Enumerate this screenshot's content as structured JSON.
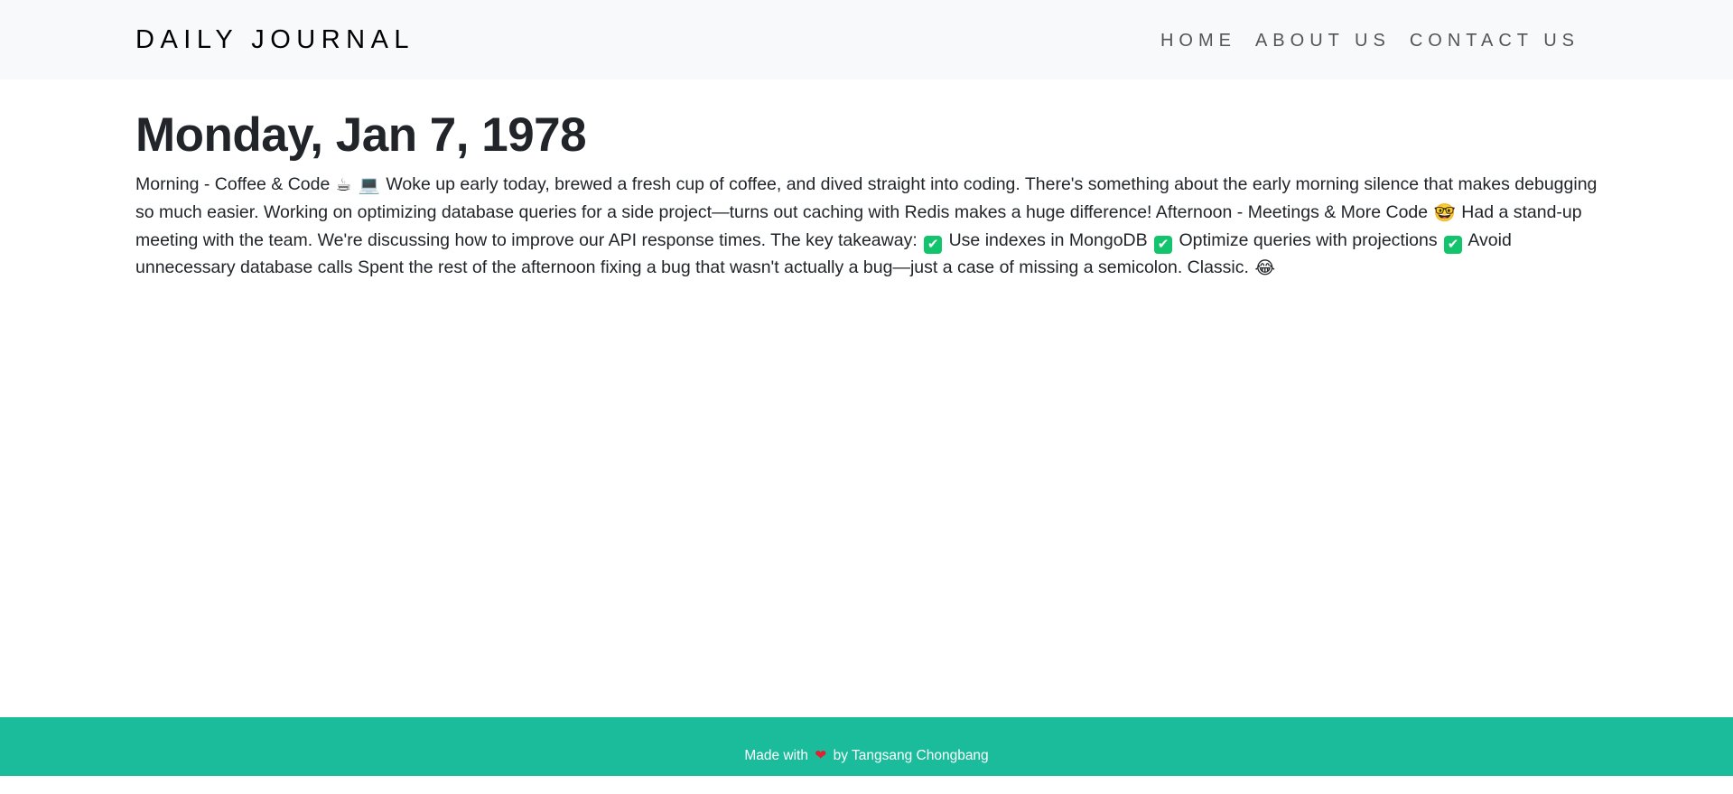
{
  "navbar": {
    "brand": "DAILY JOURNAL",
    "links": [
      {
        "label": "HOME"
      },
      {
        "label": "ABOUT US"
      },
      {
        "label": "CONTACT US"
      }
    ]
  },
  "entry": {
    "title": "Monday, Jan 7, 1978",
    "body": {
      "seg1": "Morning - Coffee & Code",
      "icon_coffee": "☕",
      "icon_laptop": "💻",
      "seg2": "Woke up early today, brewed a fresh cup of coffee, and dived straight into coding. There's something about the early morning silence that makes debugging so much easier. Working on optimizing database queries for a side project—turns out caching with Redis makes a huge difference! Afternoon - Meetings & More Code",
      "icon_nerd": "🤓",
      "seg3": "Had a stand-up meeting with the team. We're discussing how to improve our API response times. The key takeaway:",
      "check_mark": "✔",
      "item1": "Use indexes in MongoDB",
      "item2": "Optimize queries with projections",
      "item3": "Avoid unnecessary database calls",
      "seg4": "Spent the rest of the afternoon fixing a bug that wasn't actually a bug—just a case of missing a semicolon. Classic.",
      "icon_laugh": "😂"
    }
  },
  "footer": {
    "prefix": "Made with",
    "heart": "❤",
    "suffix": "by Tangsang Chongbang"
  },
  "colors": {
    "navbar_bg": "#f8f9fa",
    "footer_bg": "#1abc9c",
    "check_green": "#12c46b",
    "heart_red": "#e0212f"
  }
}
